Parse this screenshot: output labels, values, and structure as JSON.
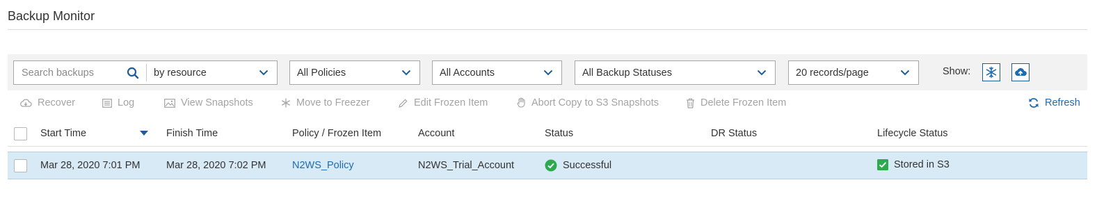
{
  "page": {
    "title": "Backup Monitor"
  },
  "filters": {
    "search_placeholder": "Search backups",
    "search_scope": "by resource",
    "policy": "All Policies",
    "account": "All Accounts",
    "backup_status": "All Backup Statuses",
    "page_size": "20 records/page",
    "show_label": "Show:"
  },
  "toolbar": {
    "recover": "Recover",
    "log": "Log",
    "view_snapshots": "View Snapshots",
    "move_to_freezer": "Move to Freezer",
    "edit_frozen_item": "Edit Frozen Item",
    "abort_copy": "Abort Copy to S3 Snapshots",
    "delete_frozen_item": "Delete Frozen Item",
    "refresh": "Refresh"
  },
  "table": {
    "columns": {
      "start_time": "Start Time",
      "finish_time": "Finish Time",
      "policy": "Policy / Frozen Item",
      "account": "Account",
      "status": "Status",
      "dr_status": "DR Status",
      "lifecycle_status": "Lifecycle Status"
    },
    "rows": [
      {
        "start_time": "Mar 28, 2020 7:01 PM",
        "finish_time": "Mar 28, 2020 7:02 PM",
        "policy": "N2WS_Policy",
        "account": "N2WS_Trial_Account",
        "status": "Successful",
        "dr_status": "",
        "lifecycle_status": "Stored in S3"
      }
    ]
  },
  "colors": {
    "accent": "#1e5d99",
    "link": "#1e6bb0",
    "success": "#2bab4e",
    "row_selected": "#d9eaf7",
    "disabled_text": "#a4a4a4"
  },
  "icons": {
    "search": "search-icon",
    "freezer_toggle": "snowflake-icon",
    "s3_toggle": "cloud-upload-icon",
    "refresh": "refresh-icon",
    "status_success": "check-circle-icon",
    "lifecycle": "checkbox-checked-icon"
  }
}
